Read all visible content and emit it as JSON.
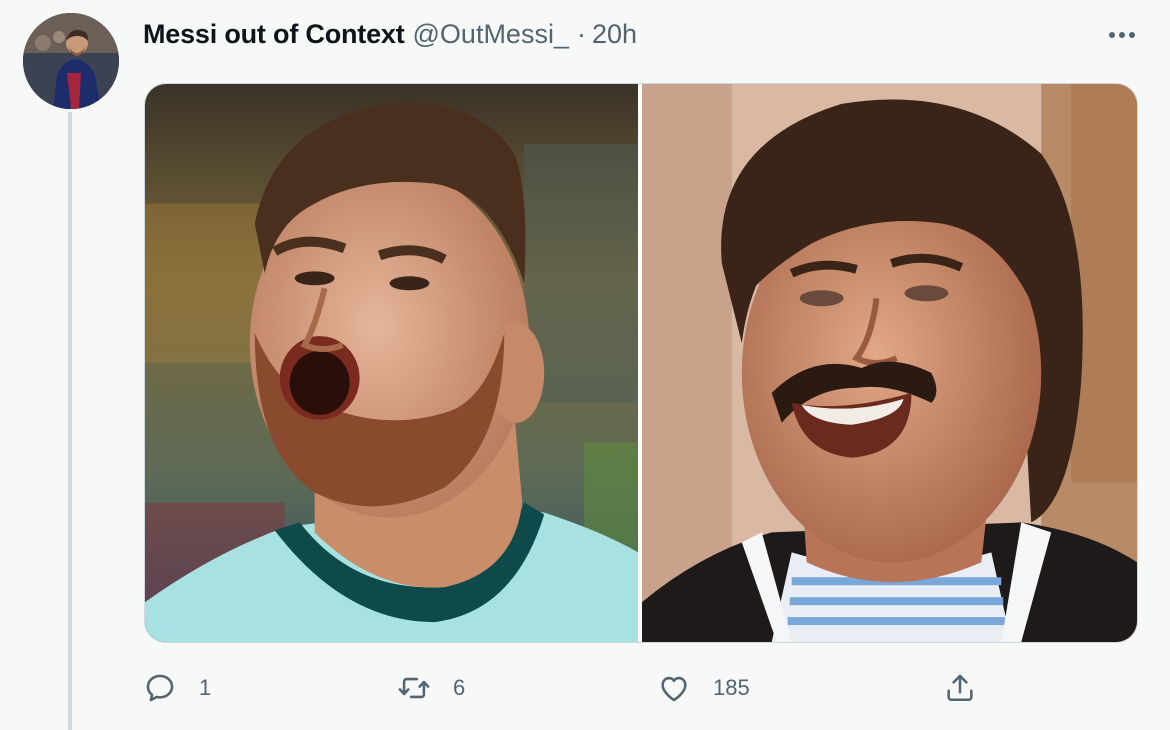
{
  "tweet": {
    "author": {
      "display_name": "Messi out of Context",
      "handle": "@OutMessi_",
      "separator": "·",
      "time": "20h"
    },
    "media": [
      {
        "icon": "photo-left"
      },
      {
        "icon": "photo-right"
      }
    ],
    "actions": {
      "reply_count": "1",
      "retweet_count": "6",
      "like_count": "185"
    },
    "icons": {
      "more": "more-horizontal-icon",
      "reply": "reply-icon",
      "retweet": "retweet-icon",
      "like": "heart-icon",
      "share": "share-icon"
    },
    "colors": {
      "background": "#f7f9f9",
      "primary_text": "#0f1419",
      "secondary_text": "#536471",
      "thread_line": "#cfd9de"
    }
  }
}
